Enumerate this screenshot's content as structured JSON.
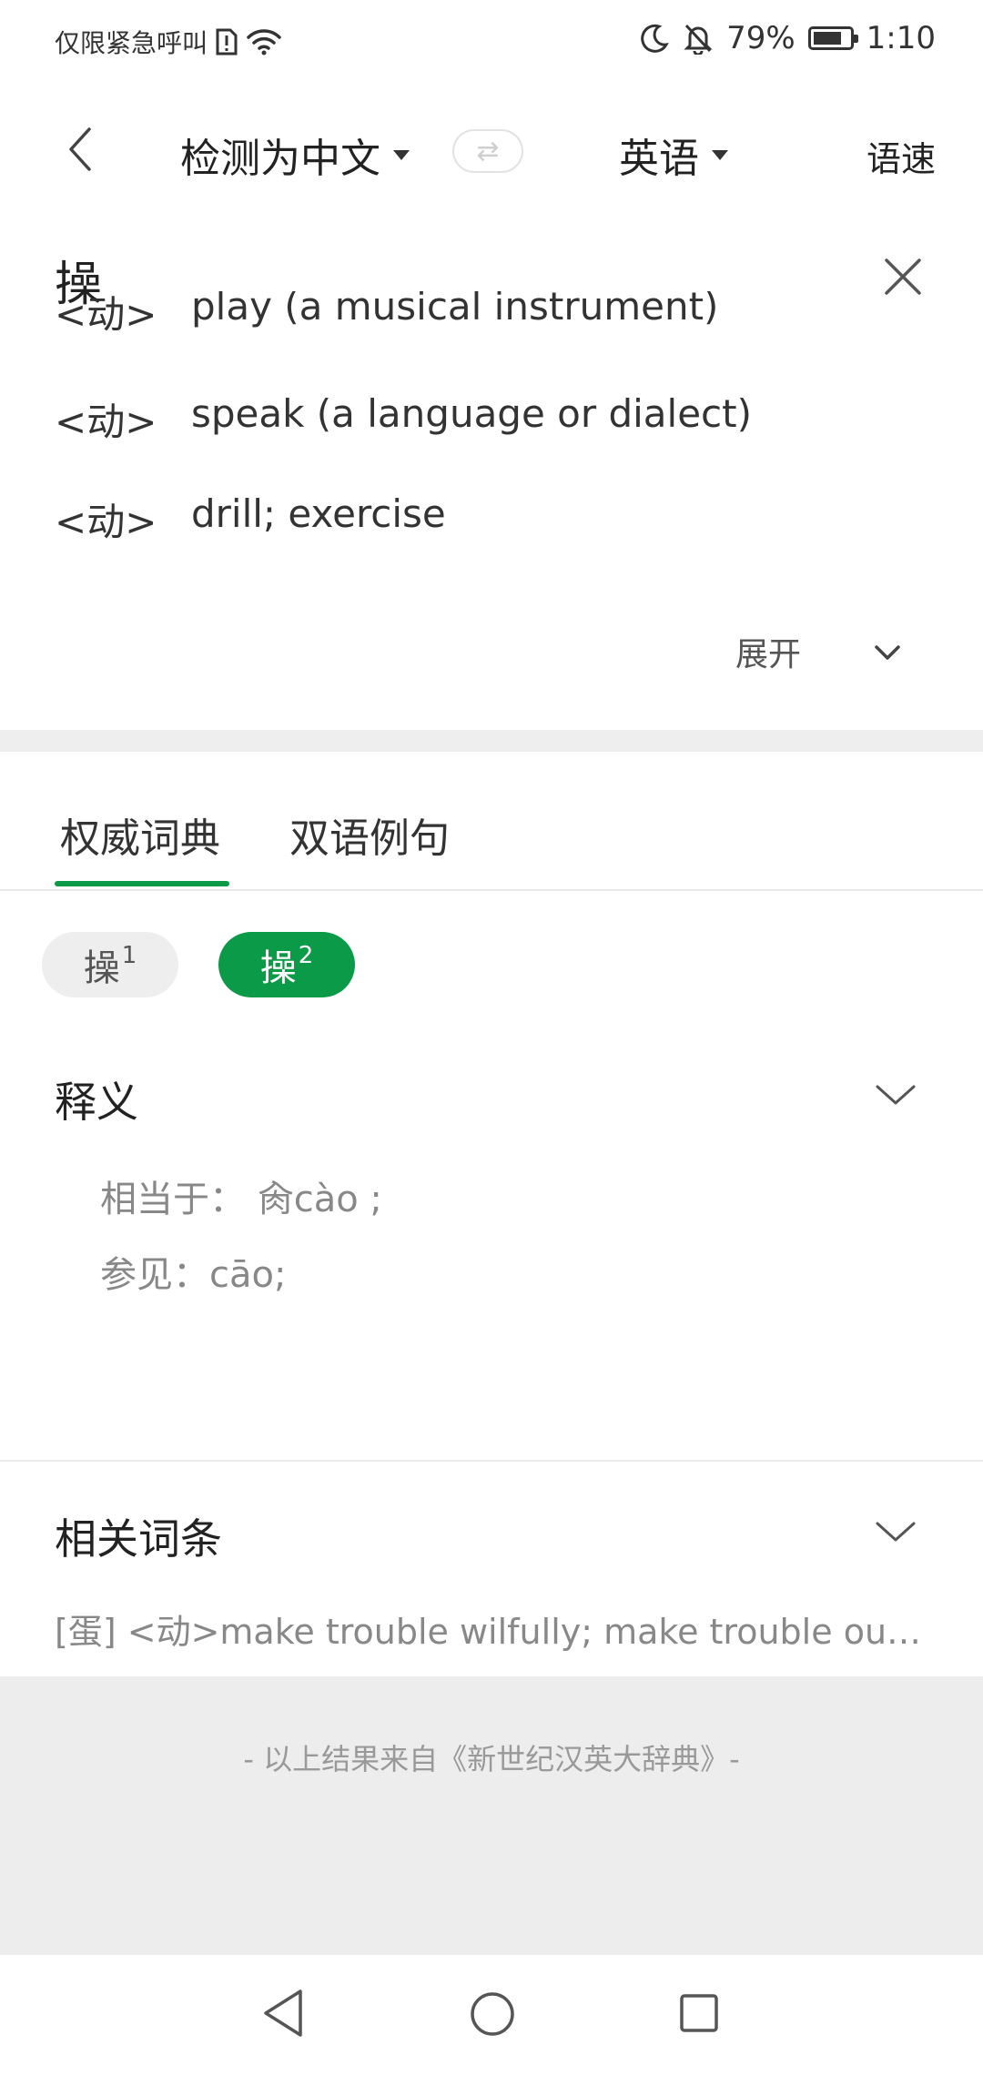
{
  "status_bar": {
    "carrier_text": "仅限紧急呼叫",
    "battery_percent": "79%",
    "battery_level": 0.79,
    "time": "1:10",
    "icons": [
      "sim-alert-icon",
      "wifi-icon",
      "moon-icon",
      "bell-off-icon",
      "battery-icon"
    ]
  },
  "header": {
    "source_language": "检测为中文",
    "target_language": "英语",
    "speed_label": "语速"
  },
  "query": {
    "text": "操"
  },
  "definitions": [
    {
      "pos": "<动>",
      "text": "play (a musical instrument)"
    },
    {
      "pos": "<动>",
      "text": "speak (a language or dialect)"
    },
    {
      "pos": "<动>",
      "text": "drill; exercise"
    }
  ],
  "expand_label": "展开",
  "tabs": [
    {
      "label": "权威词典",
      "active": true
    },
    {
      "label": "双语例句",
      "active": false
    }
  ],
  "chips": [
    {
      "label": "操",
      "sup": "1",
      "selected": false
    },
    {
      "label": "操",
      "sup": "2",
      "selected": true
    }
  ],
  "shiyi": {
    "title": "释义",
    "line1": "相当于：  肏cào ;",
    "line2": "参见：cāo;"
  },
  "related": {
    "title": "相关词条",
    "text": "[蛋] <动>make trouble wilfully; make trouble out of..."
  },
  "footer": {
    "source_text": "- 以上结果来自《新世纪汉英大辞典》-"
  },
  "colors": {
    "accent": "#0b9a47",
    "background": "#ffffff",
    "band": "#ededed"
  }
}
